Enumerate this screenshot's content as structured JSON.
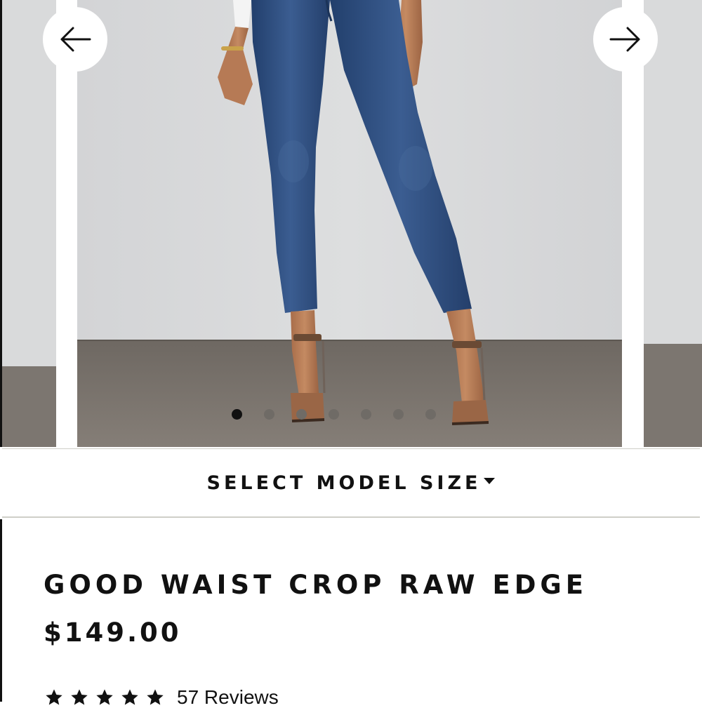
{
  "carousel": {
    "prev_icon": "arrow-left-icon",
    "next_icon": "arrow-right-icon",
    "image_alt": "",
    "slide_count": 7,
    "active_index": 0
  },
  "model_size": {
    "label": "SELECT MODEL SIZE",
    "icon": "caret-down-icon"
  },
  "product": {
    "title": "GOOD WAIST CROP RAW EDGE",
    "price": "$149.00"
  },
  "rating": {
    "stars": 5,
    "reviews_label": "57 Reviews"
  },
  "colors": {
    "text": "#111111",
    "denim": "#2e4d7e",
    "wall": "#d8d9da",
    "floor": "#7a746e"
  }
}
